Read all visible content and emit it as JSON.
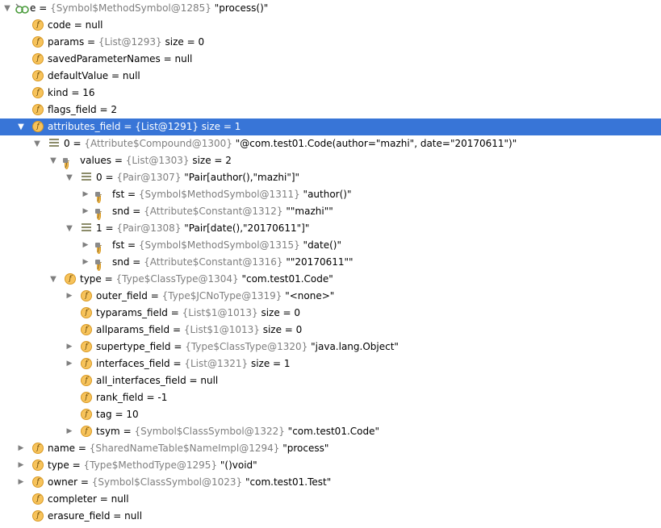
{
  "rows": [
    {
      "level": 0,
      "expander": "down",
      "icon": "watch",
      "name": "e",
      "eq": " = ",
      "obj": "{Symbol$MethodSymbol@1285}",
      "value": " \"process()\""
    },
    {
      "level": 1,
      "expander": "none",
      "icon": "field",
      "name": "code",
      "eq": " = ",
      "obj": "",
      "value": "null"
    },
    {
      "level": 1,
      "expander": "none",
      "icon": "field",
      "name": "params",
      "eq": " = ",
      "obj": "{List@1293}",
      "value": "  size = 0"
    },
    {
      "level": 1,
      "expander": "none",
      "icon": "field",
      "name": "savedParameterNames",
      "eq": " = ",
      "obj": "",
      "value": "null"
    },
    {
      "level": 1,
      "expander": "none",
      "icon": "field",
      "name": "defaultValue",
      "eq": " = ",
      "obj": "",
      "value": "null"
    },
    {
      "level": 1,
      "expander": "none",
      "icon": "field",
      "name": "kind",
      "eq": " = ",
      "obj": "",
      "value": "16"
    },
    {
      "level": 1,
      "expander": "none",
      "icon": "field",
      "name": "flags_field",
      "eq": " = ",
      "obj": "",
      "value": "2"
    },
    {
      "level": 1,
      "expander": "down",
      "icon": "field",
      "name": "attributes_field",
      "eq": " = ",
      "obj": "{List@1291}",
      "value": "  size = 1",
      "selected": true
    },
    {
      "level": 2,
      "expander": "down",
      "icon": "list",
      "name": "0",
      "eq": " = ",
      "obj": "{Attribute$Compound@1300}",
      "value": " \"@com.test01.Code(author=\"mazhi\", date=\"20170611\")\""
    },
    {
      "level": 3,
      "expander": "down",
      "icon": "field-locked",
      "name": "values",
      "eq": " = ",
      "obj": "{List@1303}",
      "value": "  size = 2"
    },
    {
      "level": 4,
      "expander": "down",
      "icon": "list",
      "name": "0",
      "eq": " = ",
      "obj": "{Pair@1307}",
      "value": " \"Pair[author(),\"mazhi\"]\""
    },
    {
      "level": 5,
      "expander": "right",
      "icon": "field-locked",
      "name": "fst",
      "eq": " = ",
      "obj": "{Symbol$MethodSymbol@1311}",
      "value": " \"author()\""
    },
    {
      "level": 5,
      "expander": "right",
      "icon": "field-locked",
      "name": "snd",
      "eq": " = ",
      "obj": "{Attribute$Constant@1312}",
      "value": " \"\"mazhi\"\""
    },
    {
      "level": 4,
      "expander": "down",
      "icon": "list",
      "name": "1",
      "eq": " = ",
      "obj": "{Pair@1308}",
      "value": " \"Pair[date(),\"20170611\"]\""
    },
    {
      "level": 5,
      "expander": "right",
      "icon": "field-locked",
      "name": "fst",
      "eq": " = ",
      "obj": "{Symbol$MethodSymbol@1315}",
      "value": " \"date()\""
    },
    {
      "level": 5,
      "expander": "right",
      "icon": "field-locked",
      "name": "snd",
      "eq": " = ",
      "obj": "{Attribute$Constant@1316}",
      "value": " \"\"20170611\"\""
    },
    {
      "level": 3,
      "expander": "down",
      "icon": "field",
      "name": "type",
      "eq": " = ",
      "obj": "{Type$ClassType@1304}",
      "value": " \"com.test01.Code\""
    },
    {
      "level": 4,
      "expander": "right",
      "icon": "field",
      "name": "outer_field",
      "eq": " = ",
      "obj": "{Type$JCNoType@1319}",
      "value": " \"<none>\""
    },
    {
      "level": 4,
      "expander": "none",
      "icon": "field",
      "name": "typarams_field",
      "eq": " = ",
      "obj": "{List$1@1013}",
      "value": "  size = 0"
    },
    {
      "level": 4,
      "expander": "none",
      "icon": "field",
      "name": "allparams_field",
      "eq": " = ",
      "obj": "{List$1@1013}",
      "value": "  size = 0"
    },
    {
      "level": 4,
      "expander": "right",
      "icon": "field",
      "name": "supertype_field",
      "eq": " = ",
      "obj": "{Type$ClassType@1320}",
      "value": " \"java.lang.Object\""
    },
    {
      "level": 4,
      "expander": "right",
      "icon": "field",
      "name": "interfaces_field",
      "eq": " = ",
      "obj": "{List@1321}",
      "value": "  size = 1"
    },
    {
      "level": 4,
      "expander": "none",
      "icon": "field",
      "name": "all_interfaces_field",
      "eq": " = ",
      "obj": "",
      "value": "null"
    },
    {
      "level": 4,
      "expander": "none",
      "icon": "field",
      "name": "rank_field",
      "eq": " = ",
      "obj": "",
      "value": "-1"
    },
    {
      "level": 4,
      "expander": "none",
      "icon": "field",
      "name": "tag",
      "eq": " = ",
      "obj": "",
      "value": "10"
    },
    {
      "level": 4,
      "expander": "right",
      "icon": "field",
      "name": "tsym",
      "eq": " = ",
      "obj": "{Symbol$ClassSymbol@1322}",
      "value": " \"com.test01.Code\""
    },
    {
      "level": 1,
      "expander": "right",
      "icon": "field",
      "name": "name",
      "eq": " = ",
      "obj": "{SharedNameTable$NameImpl@1294}",
      "value": " \"process\""
    },
    {
      "level": 1,
      "expander": "right",
      "icon": "field",
      "name": "type",
      "eq": " = ",
      "obj": "{Type$MethodType@1295}",
      "value": " \"()void\""
    },
    {
      "level": 1,
      "expander": "right",
      "icon": "field",
      "name": "owner",
      "eq": " = ",
      "obj": "{Symbol$ClassSymbol@1023}",
      "value": " \"com.test01.Test\""
    },
    {
      "level": 1,
      "expander": "none",
      "icon": "field",
      "name": "completer",
      "eq": " = ",
      "obj": "",
      "value": "null"
    },
    {
      "level": 1,
      "expander": "none",
      "icon": "field",
      "name": "erasure_field",
      "eq": " = ",
      "obj": "",
      "value": "null"
    }
  ],
  "field_icon_letter": "f",
  "colors": {
    "selection": "#3875d7",
    "field_icon": "#f7c35b",
    "object_ref": "#7f7f7f"
  }
}
